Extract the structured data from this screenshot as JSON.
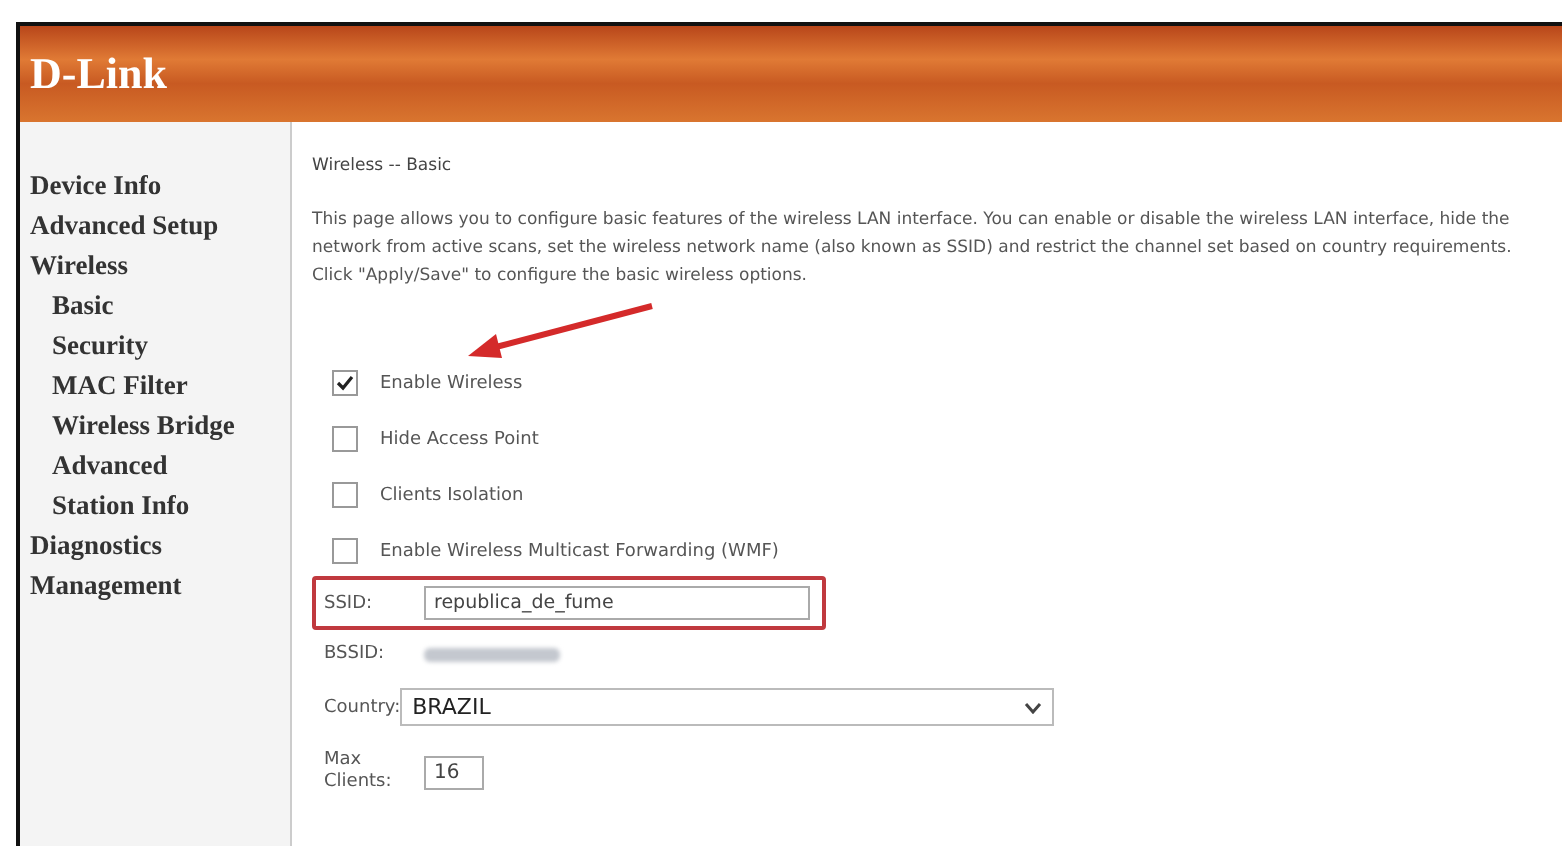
{
  "header": {
    "logo": "D-Link"
  },
  "sidebar": {
    "items": [
      {
        "label": "Device Info"
      },
      {
        "label": "Advanced Setup"
      },
      {
        "label": "Wireless",
        "children": [
          {
            "label": "Basic"
          },
          {
            "label": "Security"
          },
          {
            "label": "MAC Filter"
          },
          {
            "label": "Wireless Bridge"
          },
          {
            "label": "Advanced"
          },
          {
            "label": "Station Info"
          }
        ]
      },
      {
        "label": "Diagnostics"
      },
      {
        "label": "Management"
      }
    ]
  },
  "content": {
    "title": "Wireless -- Basic",
    "description": "This page allows you to configure basic features of the wireless LAN interface. You can enable or disable the wireless LAN interface, hide the network from active scans, set the wireless network name (also known as SSID) and restrict the channel set based on country requirements.",
    "instruction": "Click \"Apply/Save\" to configure the basic wireless options.",
    "options": [
      {
        "label": "Enable Wireless",
        "checked": true
      },
      {
        "label": "Hide Access Point",
        "checked": false
      },
      {
        "label": "Clients Isolation",
        "checked": false
      },
      {
        "label": "Enable Wireless Multicast Forwarding (WMF)",
        "checked": false
      }
    ],
    "fields": [
      {
        "kind": "text",
        "label": "SSID:",
        "value": "republica_de_fume",
        "highlighted": true
      },
      {
        "kind": "blurred",
        "label": "BSSID:"
      },
      {
        "kind": "select",
        "label": "Country:",
        "value": "BRAZIL"
      },
      {
        "kind": "small",
        "label": "Max Clients:",
        "value": "16"
      }
    ]
  }
}
